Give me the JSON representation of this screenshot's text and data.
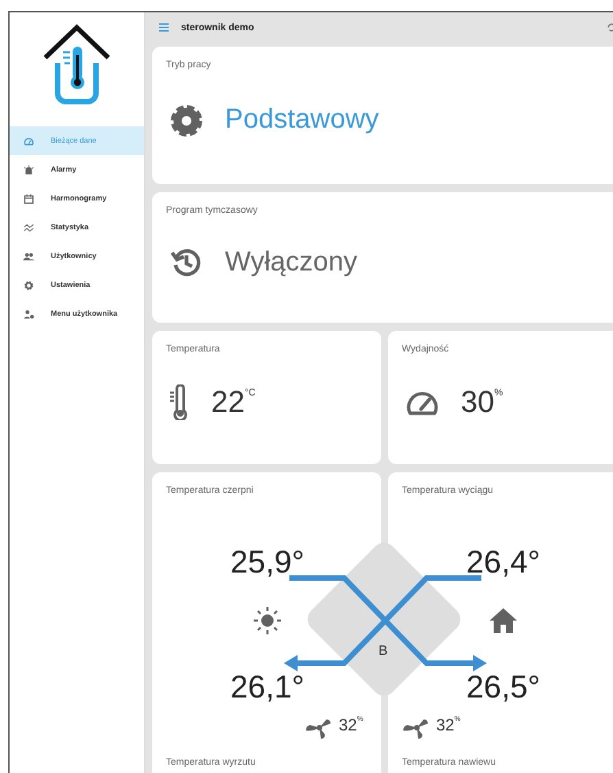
{
  "sidebar": {
    "items": [
      {
        "label": "Bieżące dane",
        "selected": true
      },
      {
        "label": "Alarmy",
        "selected": false
      },
      {
        "label": "Harmonogramy",
        "selected": false
      },
      {
        "label": "Statystyka",
        "selected": false
      },
      {
        "label": "Użytkownicy",
        "selected": false
      },
      {
        "label": "Ustawienia",
        "selected": false
      },
      {
        "label": "Menu użytkownika",
        "selected": false
      }
    ]
  },
  "header": {
    "title": "sterownik demo"
  },
  "mode_card": {
    "title": "Tryb pracy",
    "value": "Podstawowy"
  },
  "program_card": {
    "title": "Program tymczasowy",
    "value": "Wyłączony"
  },
  "temperature_card": {
    "title": "Temperatura",
    "value": "22",
    "unit": "°C"
  },
  "efficiency_card": {
    "title": "Wydajność",
    "value": "30",
    "unit": "%"
  },
  "exchanger": {
    "top_labels": [
      "Temperatura czerpni",
      "Temperatura wyciągu"
    ],
    "bottom_labels": [
      "Temperatura wyrzutu",
      "Temperatura nawiewu"
    ],
    "intake": "25,9°",
    "extract": "26,4°",
    "exhaust": "26,1°",
    "supply": "26,5°",
    "bypass": "B",
    "fans": [
      {
        "value": "32",
        "unit": "%"
      },
      {
        "value": "32",
        "unit": "%"
      }
    ]
  }
}
